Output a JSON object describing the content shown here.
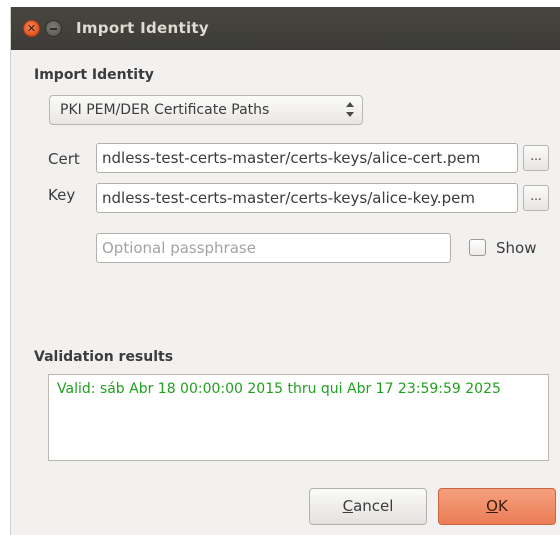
{
  "window": {
    "title": "Import Identity",
    "close_glyph": "✕"
  },
  "import_section": {
    "heading": "Import Identity",
    "type_select": {
      "value": "PKI PEM/DER Certificate Paths"
    }
  },
  "fields": {
    "cert": {
      "label": "Cert",
      "value": "ndless-test-certs-master/certs-keys/alice-cert.pem",
      "browse_label": "..."
    },
    "key": {
      "label": "Key",
      "value": "ndless-test-certs-master/certs-keys/alice-key.pem",
      "browse_label": "..."
    },
    "passphrase": {
      "placeholder": "Optional passphrase",
      "value": ""
    },
    "show_checkbox": {
      "label": "Show",
      "checked": false
    }
  },
  "validation": {
    "heading": "Validation results",
    "text": "Valid: sáb Abr 18 00:00:00 2015 thru qui Abr 17 23:59:59 2025",
    "color": "#20a020"
  },
  "buttons": {
    "cancel_mnemonic": "C",
    "cancel_rest": "ancel",
    "ok_mnemonic": "O",
    "ok_rest": "K"
  },
  "colors": {
    "titlebar": "#3c3b37",
    "ok_button": "#eb7d56",
    "close_button": "#e2541f"
  }
}
